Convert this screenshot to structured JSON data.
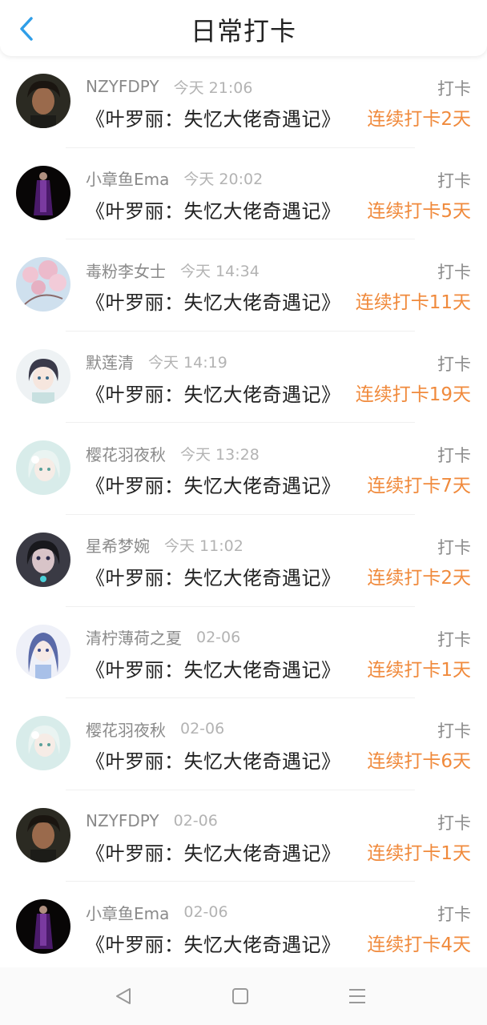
{
  "header": {
    "title": "日常打卡"
  },
  "colors": {
    "accent": "#f08a3c",
    "back": "#2f9ee8"
  },
  "records": [
    {
      "name": "NZYFDPY",
      "time": "今天 21:06",
      "action": "打卡",
      "book": "《叶罗丽：失忆大佬奇遇记》",
      "streak": "连续打卡2天",
      "avatar": "dark-hair-boy"
    },
    {
      "name": "小章鱼Ema",
      "time": "今天 20:02",
      "action": "打卡",
      "book": "《叶罗丽：失忆大佬奇遇记》",
      "streak": "连续打卡5天",
      "avatar": "dark-purple-figure"
    },
    {
      "name": "毒粉李女士",
      "time": "今天 14:34",
      "action": "打卡",
      "book": "《叶罗丽：失忆大佬奇遇记》",
      "streak": "连续打卡11天",
      "avatar": "cherry-blossom"
    },
    {
      "name": "默莲清",
      "time": "今天 14:19",
      "action": "打卡",
      "book": "《叶罗丽：失忆大佬奇遇记》",
      "streak": "连续打卡19天",
      "avatar": "anime-girl-dark-hair"
    },
    {
      "name": "樱花羽夜秋",
      "time": "今天 13:28",
      "action": "打卡",
      "book": "《叶罗丽：失忆大佬奇遇记》",
      "streak": "连续打卡7天",
      "avatar": "anime-girl-white-hair"
    },
    {
      "name": "星希梦婉",
      "time": "今天 11:02",
      "action": "打卡",
      "book": "《叶罗丽：失忆大佬奇遇记》",
      "streak": "连续打卡2天",
      "avatar": "doll-dark-hair"
    },
    {
      "name": "清柠薄荷之夏",
      "time": "02-06",
      "action": "打卡",
      "book": "《叶罗丽：失忆大佬奇遇记》",
      "streak": "连续打卡1天",
      "avatar": "anime-girl-blue-hair"
    },
    {
      "name": "樱花羽夜秋",
      "time": "02-06",
      "action": "打卡",
      "book": "《叶罗丽：失忆大佬奇遇记》",
      "streak": "连续打卡6天",
      "avatar": "anime-girl-white-hair"
    },
    {
      "name": "NZYFDPY",
      "time": "02-06",
      "action": "打卡",
      "book": "《叶罗丽：失忆大佬奇遇记》",
      "streak": "连续打卡1天",
      "avatar": "dark-hair-boy"
    },
    {
      "name": "小章鱼Ema",
      "time": "02-06",
      "action": "打卡",
      "book": "《叶罗丽：失忆大佬奇遇记》",
      "streak": "连续打卡4天",
      "avatar": "dark-purple-figure"
    }
  ],
  "navbar": {
    "buttons": [
      "back-triangle-icon",
      "home-square-icon",
      "menu-lines-icon"
    ]
  }
}
